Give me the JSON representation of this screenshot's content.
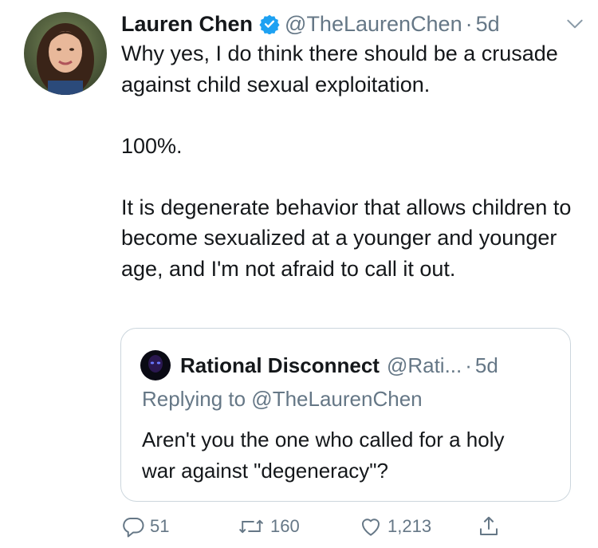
{
  "tweet": {
    "author_name": "Lauren Chen",
    "handle": "@TheLaurenChen",
    "separator": "·",
    "time": "5d",
    "paragraphs": [
      "Why yes, I do think there should be a crusade against child sexual exploitation.",
      "100%.",
      "It is degenerate behavior that allows children to become sexualized at a younger and younger age, and I'm not afraid to call it out."
    ]
  },
  "quote": {
    "author_name": "Rational Disconnect",
    "handle": "@Rati...",
    "separator": "·",
    "time": "5d",
    "reply_line": "Replying to @TheLaurenChen",
    "text": "Aren't you the one who called for a holy war against \"degeneracy\"?"
  },
  "actions": {
    "reply_count": "51",
    "retweet_count": "160",
    "like_count": "1,213"
  },
  "colors": {
    "text": "#14171a",
    "muted": "#657786",
    "verified_blue": "#1da1f2",
    "border": "#ccd6dd"
  },
  "icons": [
    "verified-badge-icon",
    "chevron-down-icon",
    "reply-icon",
    "retweet-icon",
    "like-icon",
    "share-icon"
  ]
}
